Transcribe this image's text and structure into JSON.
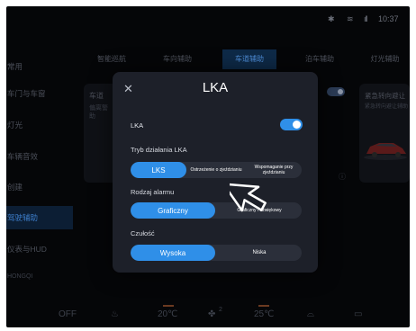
{
  "status_bar": {
    "bluetooth_icon": "bluetooth-icon",
    "wifi_icon": "wifi-icon",
    "signal_icon": "signal-icon",
    "time": "10:37"
  },
  "top_tabs": [
    {
      "label": "智能巡航"
    },
    {
      "label": "车向辅助"
    },
    {
      "label": "车道辅助"
    },
    {
      "label": "泊车辅助"
    },
    {
      "label": "灯光辅助"
    }
  ],
  "sidebar": [
    {
      "label": "常用"
    },
    {
      "label": "车门与车窗"
    },
    {
      "label": "灯光"
    },
    {
      "label": "车辆音效"
    },
    {
      "label": "创建"
    },
    {
      "label": "驾驶辅助"
    },
    {
      "label": "仪表与HUD"
    },
    {
      "label": "HONGQI"
    }
  ],
  "background": {
    "card_left_title": "车道",
    "card_left_sub1": "偏离警",
    "card_left_sub2": "助",
    "card_right_title": "紧急转向避让",
    "card_right_sub": "紧急转向避让辅助"
  },
  "climate": {
    "power": "OFF",
    "seat_icon": "seat-heat-icon",
    "temp_left": "20℃",
    "fan_icon": "fan-icon",
    "fan_level": "2",
    "temp_right": "25℃",
    "defrost_front_icon": "defrost-front-icon",
    "defrost_rear_icon": "defrost-rear-icon"
  },
  "modal": {
    "title": "LKA",
    "close_icon": "close-icon",
    "lka_label": "LKA",
    "lka_enabled": true,
    "mode_label": "Tryb działania LKA",
    "mode_options": [
      {
        "label": "LKS",
        "active": true
      },
      {
        "label": "Ostrzeżenie o zjeździaniu",
        "active": false
      },
      {
        "label": "Wspomaganie przy zjeździaniu",
        "active": false
      }
    ],
    "alarm_label": "Rodzaj alarmu",
    "alarm_options": [
      {
        "label": "Graficzny",
        "active": true
      },
      {
        "label": "Graficzny i dźwiękowy",
        "active": false
      }
    ],
    "sensitivity_label": "Czułość",
    "sensitivity_options": [
      {
        "label": "Wysoka",
        "active": true
      },
      {
        "label": "Niska",
        "active": false
      }
    ]
  },
  "accent_color": "#2f8fe8"
}
